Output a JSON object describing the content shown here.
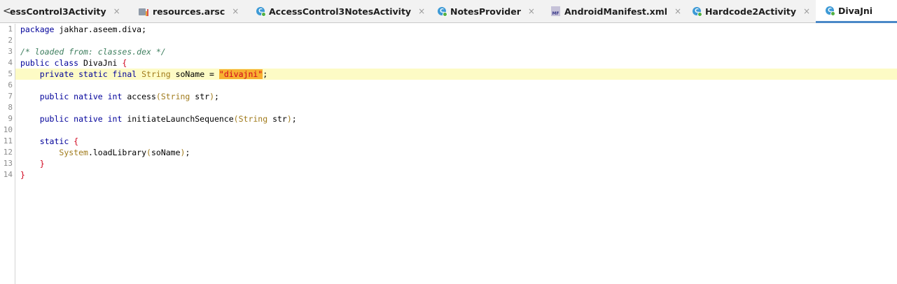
{
  "tabs": [
    {
      "label": "essControl3Activity",
      "icon": "none",
      "close": "×"
    },
    {
      "label": "resources.arsc",
      "icon": "resources-icon",
      "close": "×"
    },
    {
      "label": "AccessControl3NotesActivity",
      "icon": "class-icon",
      "close": "×"
    },
    {
      "label": "NotesProvider",
      "icon": "class-icon",
      "close": "×"
    },
    {
      "label": "AndroidManifest.xml",
      "icon": "manifest-icon",
      "close": "×"
    },
    {
      "label": "Hardcode2Activity",
      "icon": "class-icon",
      "close": "×"
    },
    {
      "label": "DivaJni",
      "icon": "class-icon",
      "active": true
    }
  ],
  "scroll_left": "<",
  "class_icon_letter": "C",
  "mf_icon_text": "MF",
  "line_numbers": [
    "1",
    "2",
    "3",
    "4",
    "5",
    "6",
    "7",
    "8",
    "9",
    "10",
    "11",
    "12",
    "13",
    "14"
  ],
  "code": {
    "l1_kw": "package",
    "l1_rest": " jakhar.aseem.diva;",
    "l3_comment": "/* loaded from: classes.dex */",
    "l4_kw": "public class",
    "l4_name": " DivaJni ",
    "l4_brace": "{",
    "l5_indent": "    ",
    "l5_kw": "private static final",
    "l5_type": " String",
    "l5_rest": " soName = ",
    "l5_str": "\"divajni\"",
    "l5_end": ";",
    "l7_kw": "public native int",
    "l7_name": " access",
    "l7_open": "(",
    "l7_type": "String",
    "l7_arg": " str",
    "l7_close": ")",
    "l7_end": ";",
    "l9_kw": "public native int",
    "l9_name": " initiateLaunchSequence",
    "l9_open": "(",
    "l9_type": "String",
    "l9_arg": " str",
    "l9_close": ")",
    "l9_end": ";",
    "l11_kw": "static",
    "l11_brace": " {",
    "l12_indent": "        ",
    "l12_type": "System",
    "l12_rest": ".loadLibrary",
    "l12_open": "(",
    "l12_arg": "soName",
    "l12_close": ")",
    "l12_end": ";",
    "l13_brace": "}",
    "l14_brace": "}"
  },
  "colors": {
    "keyword": "#00009a",
    "comment": "#3f7f5f",
    "string": "#d0021b",
    "string_highlight": "#f7b132",
    "line_highlight": "#fdfbc5",
    "active_tab_underline": "#4a88c7"
  }
}
